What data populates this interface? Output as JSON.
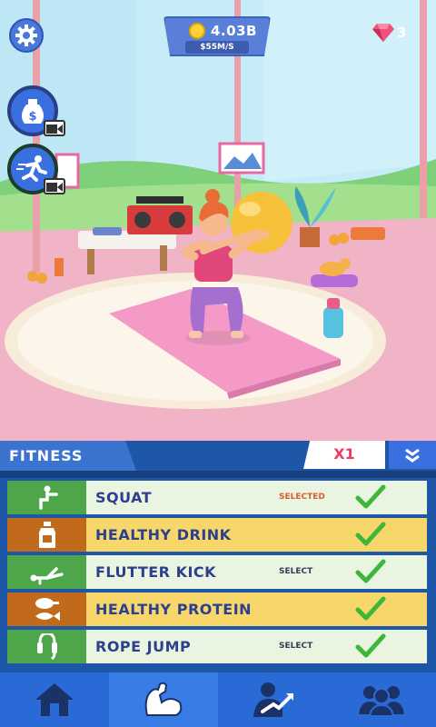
{
  "hud": {
    "coins": "4.03B",
    "coin_rate": "$55M/S",
    "gems": "3",
    "settings_icon": "gear-icon",
    "boosts": [
      {
        "name": "money-bag-icon"
      },
      {
        "name": "running-speed-icon"
      }
    ]
  },
  "panel": {
    "tab_label": "FITNESS",
    "multiplier": "X1",
    "items": [
      {
        "label": "SQUAT",
        "status": "SELECTED",
        "icon": "squat-icon",
        "style": "green",
        "status_color": "#e15a2c"
      },
      {
        "label": "HEALTHY DRINK",
        "status": "",
        "icon": "drink-bottle-icon",
        "style": "orange",
        "status_color": "#2d3f8f"
      },
      {
        "label": "FLUTTER KICK",
        "status": "SELECT",
        "icon": "flutter-kick-icon",
        "style": "green",
        "status_color": "#3a3a5a"
      },
      {
        "label": "HEALTHY PROTEIN",
        "status": "",
        "icon": "protein-food-icon",
        "style": "orange",
        "status_color": "#2d3f8f"
      },
      {
        "label": "ROPE JUMP",
        "status": "SELECT",
        "icon": "jump-rope-icon",
        "style": "green",
        "status_color": "#3a3a5a"
      }
    ]
  },
  "nav": [
    {
      "name": "home-icon",
      "active": false
    },
    {
      "name": "muscle-arm-icon",
      "active": true
    },
    {
      "name": "trainer-growth-icon",
      "active": false
    },
    {
      "name": "community-icon",
      "active": false
    }
  ],
  "colors": {
    "accent_blue": "#2a6ad6",
    "check_green": "#3cb73a",
    "selected_orange": "#e15a2c"
  }
}
